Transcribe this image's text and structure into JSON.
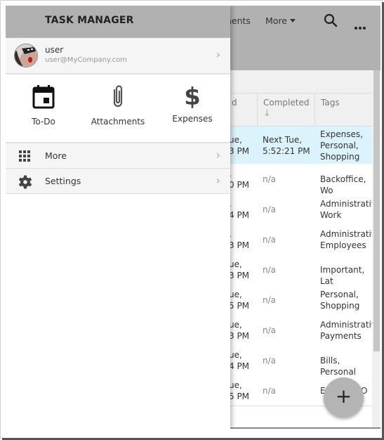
{
  "drawer": {
    "title": "TASK MANAGER",
    "user": {
      "name": "user",
      "email": "user@MyCompany.com"
    },
    "tiles": [
      {
        "icon": "calendar-icon",
        "label": "To-Do"
      },
      {
        "icon": "paperclip-icon",
        "label": "Attachments"
      },
      {
        "icon": "dollar-icon",
        "label": "Expenses"
      }
    ],
    "menu": [
      {
        "icon": "apps-grid-icon",
        "label": "More"
      },
      {
        "icon": "gear-icon",
        "label": "Settings"
      }
    ]
  },
  "header": {
    "nav_partial": "nents",
    "more_label": "More",
    "search_icon": "search-icon",
    "overflow_icon": "ellipsis-icon"
  },
  "grid": {
    "columns": [
      {
        "label": "d"
      },
      {
        "label": "Completed",
        "sort": "descending"
      },
      {
        "label": "Tags"
      }
    ],
    "rows": [
      {
        "date1": "ue,",
        "date2": "3 PM",
        "completed1": "Next Tue,",
        "completed2": "5:52:21 PM",
        "tags1": "Expenses,",
        "tags2": "Personal,",
        "tags3": "Shopping",
        "selected": true
      },
      {
        "date1": ",",
        "date2": "0 PM",
        "completed1": "n/a",
        "tags1": "Backoffice, Wo"
      },
      {
        "date1": ",",
        "date2": "4 PM",
        "completed1": "n/a",
        "tags1": "Administrative",
        "tags2": "Work"
      },
      {
        "date1": ",",
        "date2": "3 PM",
        "completed1": "n/a",
        "tags1": "Administrative",
        "tags2": "Employees"
      },
      {
        "date1": "ue,",
        "date2": "3 PM",
        "completed1": "n/a",
        "tags1": "Important, Lat"
      },
      {
        "date1": "ue,",
        "date2": "5 PM",
        "completed1": "n/a",
        "tags1": "Personal,",
        "tags2": "Shopping"
      },
      {
        "date1": "ue,",
        "date2": "3 PM",
        "completed1": "n/a",
        "tags1": "Administrative",
        "tags2": "Payments"
      },
      {
        "date1": "ue,",
        "date2": "4 PM",
        "completed1": "n/a",
        "tags1": "Bills, Personal"
      },
      {
        "date1": "ue,",
        "date2": "5 PM",
        "completed1": "n/a",
        "tags1": "E",
        "tags1b": "O"
      }
    ]
  },
  "fab": {
    "label": "+"
  }
}
